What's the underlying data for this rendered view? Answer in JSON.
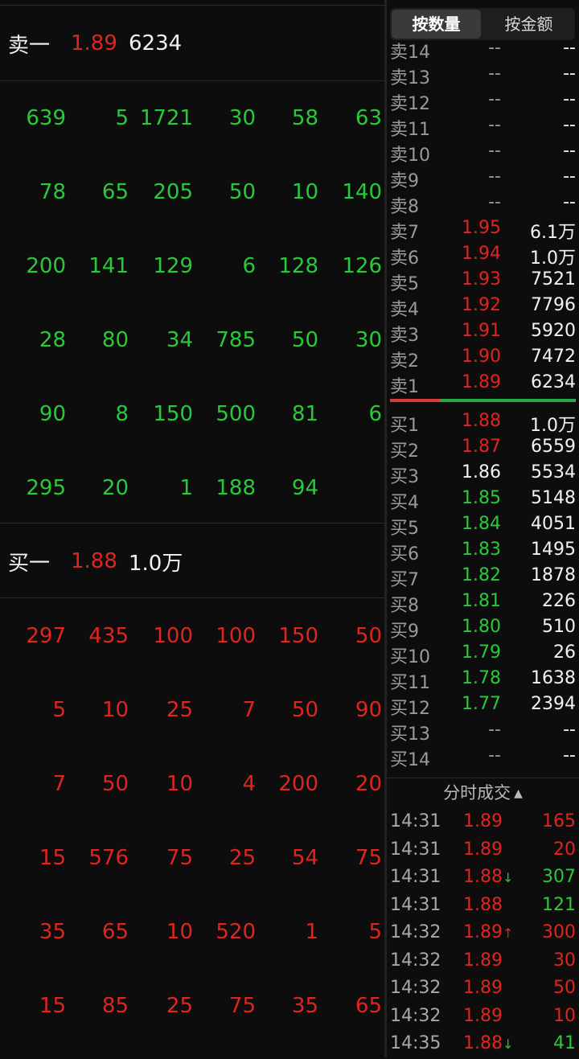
{
  "left": {
    "sell_header": {
      "label": "卖一",
      "price": "1.89",
      "volume": "6234"
    },
    "buy_header": {
      "label": "买一",
      "price": "1.88",
      "volume": "1.0万"
    },
    "sell_queue": [
      [
        "639",
        "5",
        "1721",
        "30",
        "58",
        "63"
      ],
      [
        "78",
        "65",
        "205",
        "50",
        "10",
        "140"
      ],
      [
        "200",
        "141",
        "129",
        "6",
        "128",
        "126"
      ],
      [
        "28",
        "80",
        "34",
        "785",
        "50",
        "30"
      ],
      [
        "90",
        "8",
        "150",
        "500",
        "81",
        "6"
      ],
      [
        "295",
        "20",
        "1",
        "188",
        "94",
        ""
      ]
    ],
    "buy_queue": [
      [
        "297",
        "435",
        "100",
        "100",
        "150",
        "50"
      ],
      [
        "5",
        "10",
        "25",
        "7",
        "50",
        "90"
      ],
      [
        "7",
        "50",
        "10",
        "4",
        "200",
        "20"
      ],
      [
        "15",
        "576",
        "75",
        "25",
        "54",
        "75"
      ],
      [
        "35",
        "65",
        "10",
        "520",
        "1",
        "5"
      ],
      [
        "15",
        "85",
        "25",
        "75",
        "35",
        "65"
      ]
    ]
  },
  "tabs": {
    "by_quantity": "按数量",
    "by_amount": "按金额"
  },
  "order_book": {
    "sells": [
      {
        "label": "卖14",
        "price": "--",
        "volume": "--",
        "color": "grey"
      },
      {
        "label": "卖13",
        "price": "--",
        "volume": "--",
        "color": "grey"
      },
      {
        "label": "卖12",
        "price": "--",
        "volume": "--",
        "color": "grey"
      },
      {
        "label": "卖11",
        "price": "--",
        "volume": "--",
        "color": "grey"
      },
      {
        "label": "卖10",
        "price": "--",
        "volume": "--",
        "color": "grey"
      },
      {
        "label": "卖9",
        "price": "--",
        "volume": "--",
        "color": "grey"
      },
      {
        "label": "卖8",
        "price": "--",
        "volume": "--",
        "color": "grey"
      },
      {
        "label": "卖7",
        "price": "1.95",
        "volume": "6.1万",
        "color": "red"
      },
      {
        "label": "卖6",
        "price": "1.94",
        "volume": "1.0万",
        "color": "red"
      },
      {
        "label": "卖5",
        "price": "1.93",
        "volume": "7521",
        "color": "red"
      },
      {
        "label": "卖4",
        "price": "1.92",
        "volume": "7796",
        "color": "red"
      },
      {
        "label": "卖3",
        "price": "1.91",
        "volume": "5920",
        "color": "red"
      },
      {
        "label": "卖2",
        "price": "1.90",
        "volume": "7472",
        "color": "red"
      },
      {
        "label": "卖1",
        "price": "1.89",
        "volume": "6234",
        "color": "red"
      }
    ],
    "buys": [
      {
        "label": "买1",
        "price": "1.88",
        "volume": "1.0万",
        "color": "red"
      },
      {
        "label": "买2",
        "price": "1.87",
        "volume": "6559",
        "color": "red"
      },
      {
        "label": "买3",
        "price": "1.86",
        "volume": "5534",
        "color": "white"
      },
      {
        "label": "买4",
        "price": "1.85",
        "volume": "5148",
        "color": "green"
      },
      {
        "label": "买5",
        "price": "1.84",
        "volume": "4051",
        "color": "green"
      },
      {
        "label": "买6",
        "price": "1.83",
        "volume": "1495",
        "color": "green"
      },
      {
        "label": "买7",
        "price": "1.82",
        "volume": "1878",
        "color": "green"
      },
      {
        "label": "买8",
        "price": "1.81",
        "volume": "226",
        "color": "green"
      },
      {
        "label": "买9",
        "price": "1.80",
        "volume": "510",
        "color": "green"
      },
      {
        "label": "买10",
        "price": "1.79",
        "volume": "26",
        "color": "green"
      },
      {
        "label": "买11",
        "price": "1.78",
        "volume": "1638",
        "color": "green"
      },
      {
        "label": "买12",
        "price": "1.77",
        "volume": "2394",
        "color": "green"
      },
      {
        "label": "买13",
        "price": "--",
        "volume": "--",
        "color": "grey"
      },
      {
        "label": "买14",
        "price": "--",
        "volume": "--",
        "color": "grey"
      }
    ],
    "bid_ask_ratio": {
      "sell_fraction": 0.27,
      "buy_fraction": 0.73,
      "sell_color": "#d63a3a",
      "buy_color": "#2aa64a"
    }
  },
  "ticks": {
    "title": "分时成交",
    "sort_icon": "triangle-up-icon",
    "rows": [
      {
        "time": "14:31",
        "price": "1.89",
        "dir": "",
        "volume": "165",
        "price_color": "red",
        "vol_color": "red"
      },
      {
        "time": "14:31",
        "price": "1.89",
        "dir": "",
        "volume": "20",
        "price_color": "red",
        "vol_color": "red"
      },
      {
        "time": "14:31",
        "price": "1.88",
        "dir": "↓",
        "volume": "307",
        "price_color": "red",
        "vol_color": "green"
      },
      {
        "time": "14:31",
        "price": "1.88",
        "dir": "",
        "volume": "121",
        "price_color": "red",
        "vol_color": "green"
      },
      {
        "time": "14:32",
        "price": "1.89",
        "dir": "↑",
        "volume": "300",
        "price_color": "red",
        "vol_color": "red"
      },
      {
        "time": "14:32",
        "price": "1.89",
        "dir": "",
        "volume": "30",
        "price_color": "red",
        "vol_color": "red"
      },
      {
        "time": "14:32",
        "price": "1.89",
        "dir": "",
        "volume": "50",
        "price_color": "red",
        "vol_color": "red"
      },
      {
        "time": "14:32",
        "price": "1.89",
        "dir": "",
        "volume": "10",
        "price_color": "red",
        "vol_color": "red"
      },
      {
        "time": "14:35",
        "price": "1.88",
        "dir": "↓",
        "volume": "41",
        "price_color": "red",
        "vol_color": "green"
      }
    ]
  },
  "colors": {
    "red": "#e0241f",
    "green": "#2ac93a",
    "background": "#0d0d0d"
  }
}
